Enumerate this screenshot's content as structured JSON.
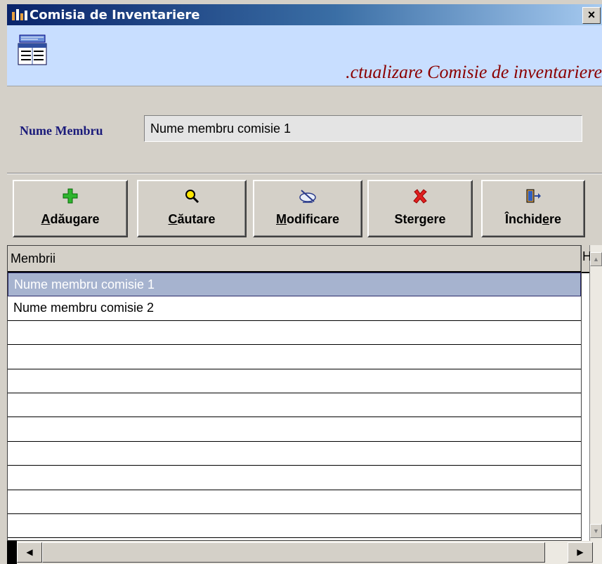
{
  "window": {
    "title": "Comisia de Inventariere",
    "close_label": "×"
  },
  "header": {
    "icon": "table-form-icon",
    "title": ".ctualizare Comisie de inventariere"
  },
  "form": {
    "member_label": "Nume Membru",
    "member_value": "Nume membru comisie 1"
  },
  "toolbar": {
    "add": {
      "pre": "",
      "ul": "A",
      "post": "dăugare",
      "icon": "plus-icon"
    },
    "search": {
      "pre": "",
      "ul": "C",
      "post": "ăutare",
      "icon": "magnifier-icon"
    },
    "edit": {
      "pre": "",
      "ul": "M",
      "post": "odificare",
      "icon": "edit-icon"
    },
    "delete": {
      "label": "Stergere",
      "icon": "delete-x-icon"
    },
    "close": {
      "pre": "Închid",
      "ul": "e",
      "post": "re",
      "icon": "exit-door-icon"
    }
  },
  "grid": {
    "column_header": "Membrii",
    "next_column_header": "H",
    "rows": [
      "Nume membru comisie 1",
      "Nume membru comisie 2",
      "",
      "",
      "",
      "",
      "",
      "",
      "",
      "",
      ""
    ],
    "selected_index": 0
  },
  "colors": {
    "title_bar": "#0a246a",
    "header_band": "#c8deff",
    "header_title": "#8b0000",
    "selection": "#a6b3cf",
    "window_bg": "#d4d0c8"
  }
}
